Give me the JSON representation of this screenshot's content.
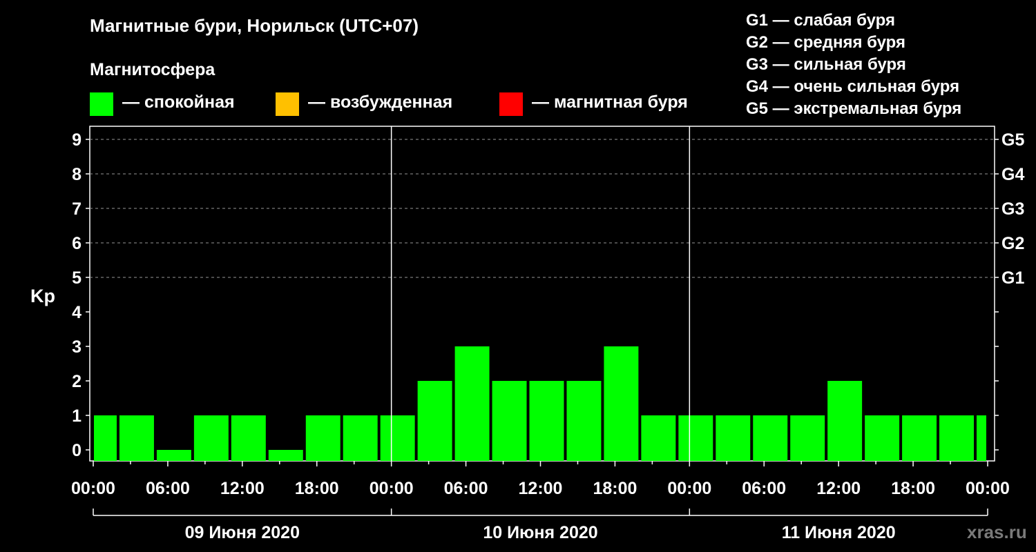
{
  "title": "Магнитные бури, Норильск (UTC+07)",
  "subtitle": "Магнитосфера",
  "legend": [
    {
      "label": "— спокойная",
      "color": "#00ff00"
    },
    {
      "label": "— возбужденная",
      "color": "#ffc000"
    },
    {
      "label": "— магнитная буря",
      "color": "#ff0000"
    }
  ],
  "g_legend": [
    "G1 — слабая буря",
    "G2 — средняя буря",
    "G3 — сильная буря",
    "G4 — очень сильная буря",
    "G5 — экстремальная буря"
  ],
  "watermark": "xras.ru",
  "chart_data": {
    "type": "bar",
    "ylabel": "Kp",
    "ylim": [
      0,
      9
    ],
    "y_ticks": [
      0,
      1,
      2,
      3,
      4,
      5,
      6,
      7,
      8,
      9
    ],
    "g_ticks": [
      {
        "kp": 5,
        "label": "G1"
      },
      {
        "kp": 6,
        "label": "G2"
      },
      {
        "kp": 7,
        "label": "G3"
      },
      {
        "kp": 8,
        "label": "G4"
      },
      {
        "kp": 9,
        "label": "G5"
      }
    ],
    "grid": "horizontal dashed at Kp 5–9",
    "x_ticks": [
      "00:00",
      "06:00",
      "12:00",
      "18:00",
      "00:00",
      "06:00",
      "12:00",
      "18:00",
      "00:00",
      "06:00",
      "12:00",
      "18:00",
      "00:00"
    ],
    "days": [
      "09 Июня 2020",
      "10 Июня 2020",
      "11 Июня 2020"
    ],
    "interval_hours": 3,
    "start_offset_hours": -1,
    "values": [
      1,
      1,
      0,
      1,
      1,
      0,
      1,
      1,
      1,
      2,
      3,
      2,
      2,
      2,
      3,
      1,
      1,
      1,
      1,
      1,
      2,
      1,
      1,
      1,
      1
    ],
    "colors": {
      "quiet": "#00ff00",
      "active": "#ffc000",
      "storm": "#ff0000"
    }
  }
}
